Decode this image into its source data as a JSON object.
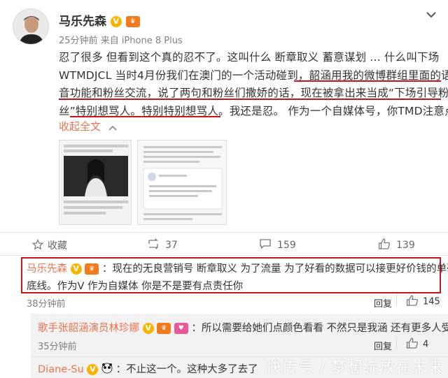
{
  "post": {
    "author": "马乐先森",
    "time": "25分钟前",
    "source": "来自 iPhone 8 Plus",
    "lines": [
      "忍了很多 但看到这个真的忍不了。这叫什么 断章取义 蓄意谋划 ... 什么叫下场",
      "WTMDJCL 当时4月份我们在澳门的一个活动碰到，韶涵用我的微博群组里面的语",
      "音功能和粉丝交流，说了两句和粉丝们撒娇的话，现在被拿出来当成“下场引导粉",
      "丝”特别想骂人。特别特别想骂人。我还是忍。 作为一个自媒体号，你TMD注意点"
    ],
    "collapse_label": "收起全文"
  },
  "actions": {
    "favorite_label": "收藏",
    "repost_count": "37",
    "comment_count": "159",
    "like_count": "139"
  },
  "comments": [
    {
      "name": "马乐先森",
      "text": "：现在的无良营销号 断章取义 为了流量 为了好看的数据可以接更好价钱的单毫无",
      "text2": "底线。作为V 作为自媒体 你是不是要有点责任你",
      "time": "38分钟前",
      "reply_label": "回复",
      "likes": "145"
    },
    {
      "name": "歌手张韶涵演员林珍娜",
      "text": "：所以需要给她们点颜色看看 不然只是我涵 还有更多人受难",
      "time": "35分钟前",
      "reply_label": "回复",
      "likes": "4"
    },
    {
      "name": "Diane-Su",
      "text": "：不止这一个。这种大多了去了"
    }
  ],
  "watermark": "快传号 / 梦想绽放在未来",
  "colors": {
    "accent": "#eb7350",
    "highlight_red": "#c8151b",
    "vip_gold": "#f7b500"
  }
}
